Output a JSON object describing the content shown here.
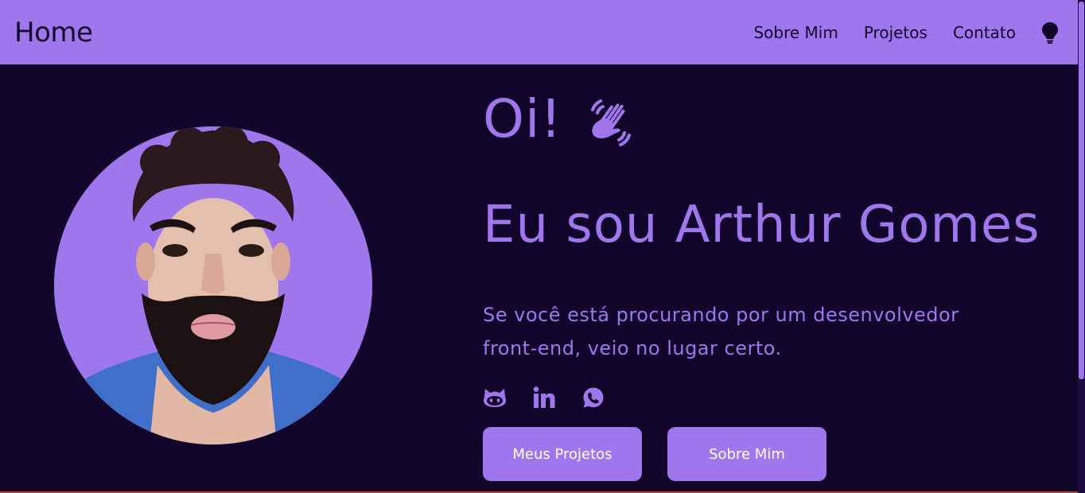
{
  "nav": {
    "brand": "Home",
    "links": [
      "Sobre Mim",
      "Projetos",
      "Contato"
    ],
    "theme_toggle_icon": "lightbulb-icon"
  },
  "hero": {
    "greeting": "Oi!",
    "greeting_icon": "waving-hand-icon",
    "headline": "Eu sou Arthur Gomes",
    "tagline": "Se você está procurando por um desenvolvedor front-end, veio no lugar certo.",
    "socials": [
      "github-icon",
      "linkedin-icon",
      "whatsapp-icon"
    ],
    "buttons": [
      "Meus Projetos",
      "Sobre Mim"
    ]
  },
  "colors": {
    "background": "#11052c",
    "accent": "#a076ec",
    "button_text": "#ffffff"
  }
}
